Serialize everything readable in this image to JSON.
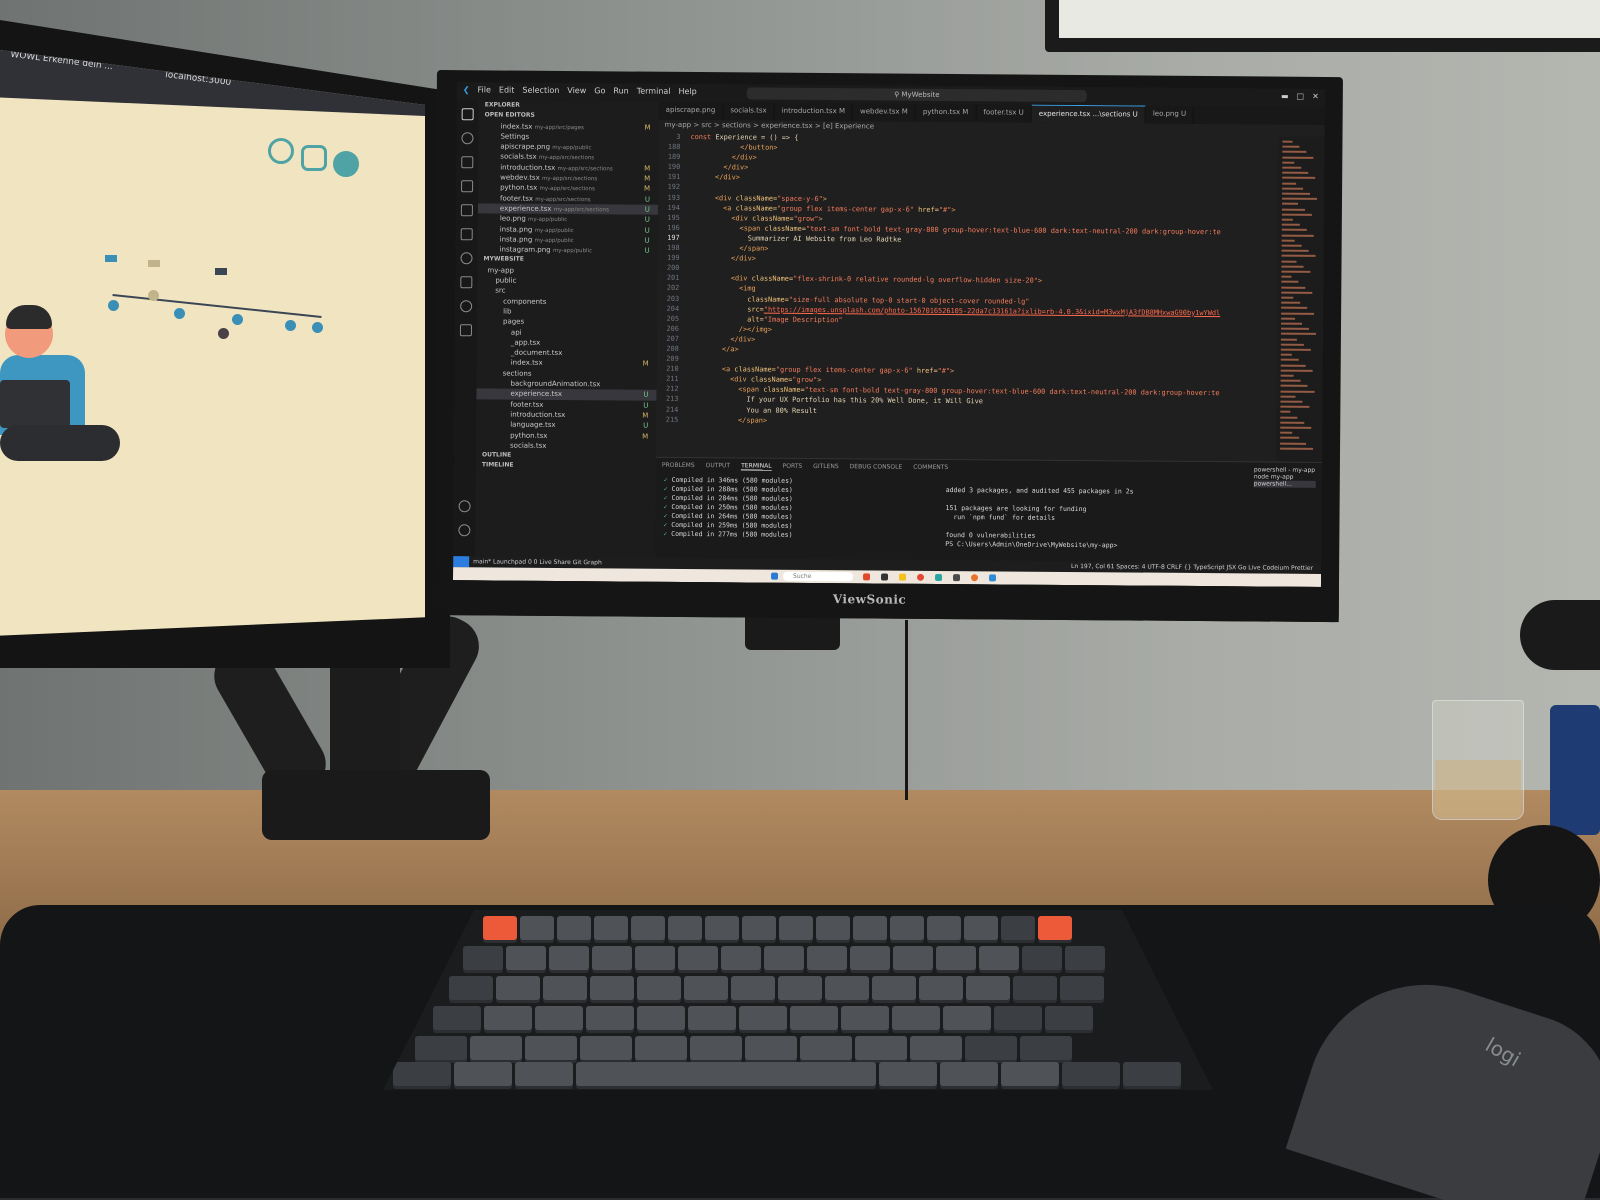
{
  "monitor_brand": "ViewSonic",
  "left_monitor": {
    "tab_title": "WOWL Erkenne dein ...",
    "tab2_title": "localhost:3000",
    "social_icons": [
      "github-icon",
      "instagram-icon",
      "mail-icon"
    ]
  },
  "vscode": {
    "menu": [
      "File",
      "Edit",
      "Selection",
      "View",
      "Go",
      "Run",
      "Terminal",
      "Help"
    ],
    "command_center": "MyWebsite",
    "explorer": {
      "title": "EXPLORER",
      "open_editors_label": "OPEN EDITORS",
      "open_editors": [
        {
          "name": "index.tsx",
          "path": "my-app/src/pages",
          "status": "M"
        },
        {
          "name": "Settings",
          "path": "",
          "status": ""
        },
        {
          "name": "apiscrape.png",
          "path": "my-app/public",
          "status": ""
        },
        {
          "name": "socials.tsx",
          "path": "my-app/src/sections",
          "status": ""
        },
        {
          "name": "introduction.tsx",
          "path": "my-app/src/sections",
          "status": "M"
        },
        {
          "name": "webdev.tsx",
          "path": "my-app/src/sections",
          "status": "M"
        },
        {
          "name": "python.tsx",
          "path": "my-app/src/sections",
          "status": "M"
        },
        {
          "name": "footer.tsx",
          "path": "my-app/src/sections",
          "status": "U"
        },
        {
          "name": "experience.tsx",
          "path": "my-app/src/sections",
          "status": "U"
        },
        {
          "name": "leo.png",
          "path": "my-app/public",
          "status": "U"
        },
        {
          "name": "insta.png",
          "path": "my-app/public",
          "status": "U"
        },
        {
          "name": "insta.png",
          "path": "my-app/public",
          "status": "U"
        },
        {
          "name": "instagram.png",
          "path": "my-app/public",
          "status": "U"
        }
      ],
      "workspace_label": "MYWEBSITE",
      "tree": [
        {
          "name": "my-app",
          "status": ""
        },
        {
          "name": "public",
          "status": ""
        },
        {
          "name": "src",
          "status": ""
        },
        {
          "name": "components",
          "status": ""
        },
        {
          "name": "lib",
          "status": ""
        },
        {
          "name": "pages",
          "status": ""
        },
        {
          "name": "api",
          "status": ""
        },
        {
          "name": "_app.tsx",
          "status": ""
        },
        {
          "name": "_document.tsx",
          "status": ""
        },
        {
          "name": "index.tsx",
          "status": "M"
        },
        {
          "name": "sections",
          "status": ""
        },
        {
          "name": "backgroundAnimation.tsx",
          "status": ""
        },
        {
          "name": "experience.tsx",
          "status": "U"
        },
        {
          "name": "footer.tsx",
          "status": "U"
        },
        {
          "name": "introduction.tsx",
          "status": "M"
        },
        {
          "name": "language.tsx",
          "status": "U"
        },
        {
          "name": "python.tsx",
          "status": "M"
        },
        {
          "name": "socials.tsx",
          "status": ""
        }
      ],
      "outline_label": "OUTLINE",
      "timeline_label": "TIMELINE"
    },
    "tabs": [
      {
        "label": "apiscrape.png",
        "active": false
      },
      {
        "label": "socials.tsx",
        "active": false
      },
      {
        "label": "introduction.tsx M",
        "active": false
      },
      {
        "label": "webdev.tsx M",
        "active": false
      },
      {
        "label": "python.tsx M",
        "active": false
      },
      {
        "label": "footer.tsx U",
        "active": false
      },
      {
        "label": "experience.tsx ...\\sections U",
        "active": true
      },
      {
        "label": "leo.png U",
        "active": false
      }
    ],
    "breadcrumb": "my-app > src > sections > experience.tsx > [e] Experience",
    "code_lines": [
      {
        "n": "3",
        "segs": [
          [
            "kw",
            "const "
          ],
          [
            "tx",
            "Experience = () => {"
          ]
        ]
      },
      {
        "n": "188",
        "segs": [
          [
            "tx",
            "            "
          ],
          [
            "tg",
            "</button>"
          ]
        ]
      },
      {
        "n": "189",
        "segs": [
          [
            "tx",
            "          "
          ],
          [
            "tg",
            "</div>"
          ]
        ]
      },
      {
        "n": "190",
        "segs": [
          [
            "tx",
            "        "
          ],
          [
            "tg",
            "</div>"
          ]
        ]
      },
      {
        "n": "191",
        "segs": [
          [
            "tx",
            "      "
          ],
          [
            "tg",
            "</div>"
          ]
        ]
      },
      {
        "n": "192",
        "segs": [
          [
            "tx",
            ""
          ]
        ]
      },
      {
        "n": "193",
        "segs": [
          [
            "tx",
            "      "
          ],
          [
            "tg",
            "<div "
          ],
          [
            "at",
            "className="
          ],
          [
            "st",
            "\"space-y-6\""
          ],
          [
            "tg",
            ">"
          ]
        ]
      },
      {
        "n": "194",
        "segs": [
          [
            "tx",
            "        "
          ],
          [
            "tg",
            "<a "
          ],
          [
            "at",
            "className="
          ],
          [
            "st",
            "\"group flex items-center gap-x-6\" "
          ],
          [
            "at",
            "href="
          ],
          [
            "st",
            "\"#\""
          ],
          [
            "tg",
            ">"
          ]
        ]
      },
      {
        "n": "195",
        "segs": [
          [
            "tx",
            "          "
          ],
          [
            "tg",
            "<div "
          ],
          [
            "at",
            "className="
          ],
          [
            "st",
            "\"grow\""
          ],
          [
            "tg",
            ">"
          ]
        ]
      },
      {
        "n": "196",
        "segs": [
          [
            "tx",
            "            "
          ],
          [
            "tg",
            "<span "
          ],
          [
            "at",
            "className="
          ],
          [
            "st",
            "\"text-sm font-bold text-gray-800 group-hover:text-blue-600 dark:text-neutral-200 dark:group-hover:te"
          ]
        ]
      },
      {
        "n": "197",
        "segs": [
          [
            "tx",
            "              Summarizer AI Website from Leo Radtke"
          ]
        ]
      },
      {
        "n": "198",
        "segs": [
          [
            "tx",
            "            "
          ],
          [
            "tg",
            "</span>"
          ]
        ]
      },
      {
        "n": "199",
        "segs": [
          [
            "tx",
            "          "
          ],
          [
            "tg",
            "</div>"
          ]
        ]
      },
      {
        "n": "200",
        "segs": [
          [
            "tx",
            ""
          ]
        ]
      },
      {
        "n": "201",
        "segs": [
          [
            "tx",
            "          "
          ],
          [
            "tg",
            "<div "
          ],
          [
            "at",
            "className="
          ],
          [
            "st",
            "\"flex-shrink-0 relative rounded-lg overflow-hidden size-20\""
          ],
          [
            "tg",
            ">"
          ]
        ]
      },
      {
        "n": "202",
        "segs": [
          [
            "tx",
            "            "
          ],
          [
            "tg",
            "<img"
          ]
        ]
      },
      {
        "n": "203",
        "segs": [
          [
            "tx",
            "              "
          ],
          [
            "at",
            "className="
          ],
          [
            "st",
            "\"size-full absolute top-0 start-0 object-cover rounded-lg\""
          ]
        ]
      },
      {
        "n": "204",
        "segs": [
          [
            "tx",
            "              "
          ],
          [
            "at",
            "src="
          ],
          [
            "url",
            "\"https://images.unsplash.com/photo-1567016526105-22da7c13161a?ixlib=rb-4.0.3&ixid=M3wxMjA3fDB8MHxwaG90by1wYWdl"
          ]
        ]
      },
      {
        "n": "205",
        "segs": [
          [
            "tx",
            "              "
          ],
          [
            "at",
            "alt="
          ],
          [
            "st",
            "\"Image Description\""
          ]
        ]
      },
      {
        "n": "206",
        "segs": [
          [
            "tx",
            "            "
          ],
          [
            "tg",
            "/></img>"
          ]
        ]
      },
      {
        "n": "207",
        "segs": [
          [
            "tx",
            "          "
          ],
          [
            "tg",
            "</div>"
          ]
        ]
      },
      {
        "n": "208",
        "segs": [
          [
            "tx",
            "        "
          ],
          [
            "tg",
            "</a>"
          ]
        ]
      },
      {
        "n": "209",
        "segs": [
          [
            "tx",
            ""
          ]
        ]
      },
      {
        "n": "210",
        "segs": [
          [
            "tx",
            "        "
          ],
          [
            "tg",
            "<a "
          ],
          [
            "at",
            "className="
          ],
          [
            "st",
            "\"group flex items-center gap-x-6\" "
          ],
          [
            "at",
            "href="
          ],
          [
            "st",
            "\"#\""
          ],
          [
            "tg",
            ">"
          ]
        ]
      },
      {
        "n": "211",
        "segs": [
          [
            "tx",
            "          "
          ],
          [
            "tg",
            "<div "
          ],
          [
            "at",
            "className="
          ],
          [
            "st",
            "\"grow\""
          ],
          [
            "tg",
            ">"
          ]
        ]
      },
      {
        "n": "212",
        "segs": [
          [
            "tx",
            "            "
          ],
          [
            "tg",
            "<span "
          ],
          [
            "at",
            "className="
          ],
          [
            "st",
            "\"text-sm font-bold text-gray-800 group-hover:text-blue-600 dark:text-neutral-200 dark:group-hover:te"
          ]
        ]
      },
      {
        "n": "213",
        "segs": [
          [
            "tx",
            "              If your UX Portfolio has this 20% Well Done, it Will Give"
          ]
        ]
      },
      {
        "n": "214",
        "segs": [
          [
            "tx",
            "              You an 80% Result"
          ]
        ]
      },
      {
        "n": "215",
        "segs": [
          [
            "tx",
            "            "
          ],
          [
            "tg",
            "</span>"
          ]
        ]
      }
    ],
    "current_line": "197",
    "panel_tabs": [
      {
        "label": "PROBLEMS",
        "active": false
      },
      {
        "label": "OUTPUT",
        "active": false
      },
      {
        "label": "TERMINAL",
        "active": true
      },
      {
        "label": "PORTS",
        "active": false
      },
      {
        "label": "GITLENS",
        "active": false
      },
      {
        "label": "DEBUG CONSOLE",
        "active": false
      },
      {
        "label": "COMMENTS",
        "active": false
      }
    ],
    "terminal_left": [
      "Compiled in 346ms (580 modules)",
      "Compiled in 288ms (580 modules)",
      "Compiled in 284ms (580 modules)",
      "Compiled in 250ms (580 modules)",
      "Compiled in 264ms (580 modules)",
      "Compiled in 259ms (580 modules)",
      "Compiled in 277ms (580 modules)"
    ],
    "terminal_right": [
      "added 3 packages, and audited 455 packages in 2s",
      "",
      "151 packages are looking for funding",
      "  run `npm fund` for details",
      "",
      "found 0 vulnerabilities",
      "PS C:\\Users\\Admin\\OneDrive\\MyWebsite\\my-app> "
    ],
    "terminal_list_header": "powershell - my-app",
    "terminal_list": [
      "node my-app",
      "powershell..."
    ],
    "status_left": "main*  Launchpad  0 0  Live Share  Git Graph",
    "status_right": "Ln 197, Col 61  Spaces: 4  UTF-8  CRLF  {} TypeScript JSX  Go Live  Codeium  Prettier",
    "taskbar_search": "Suche"
  },
  "colors": {
    "accent": "#3aa1e6",
    "keyword": "#f07a56",
    "string": "#f47c5c",
    "keycap_orange": "#ec5a3a"
  },
  "mouse_brand": "logi"
}
